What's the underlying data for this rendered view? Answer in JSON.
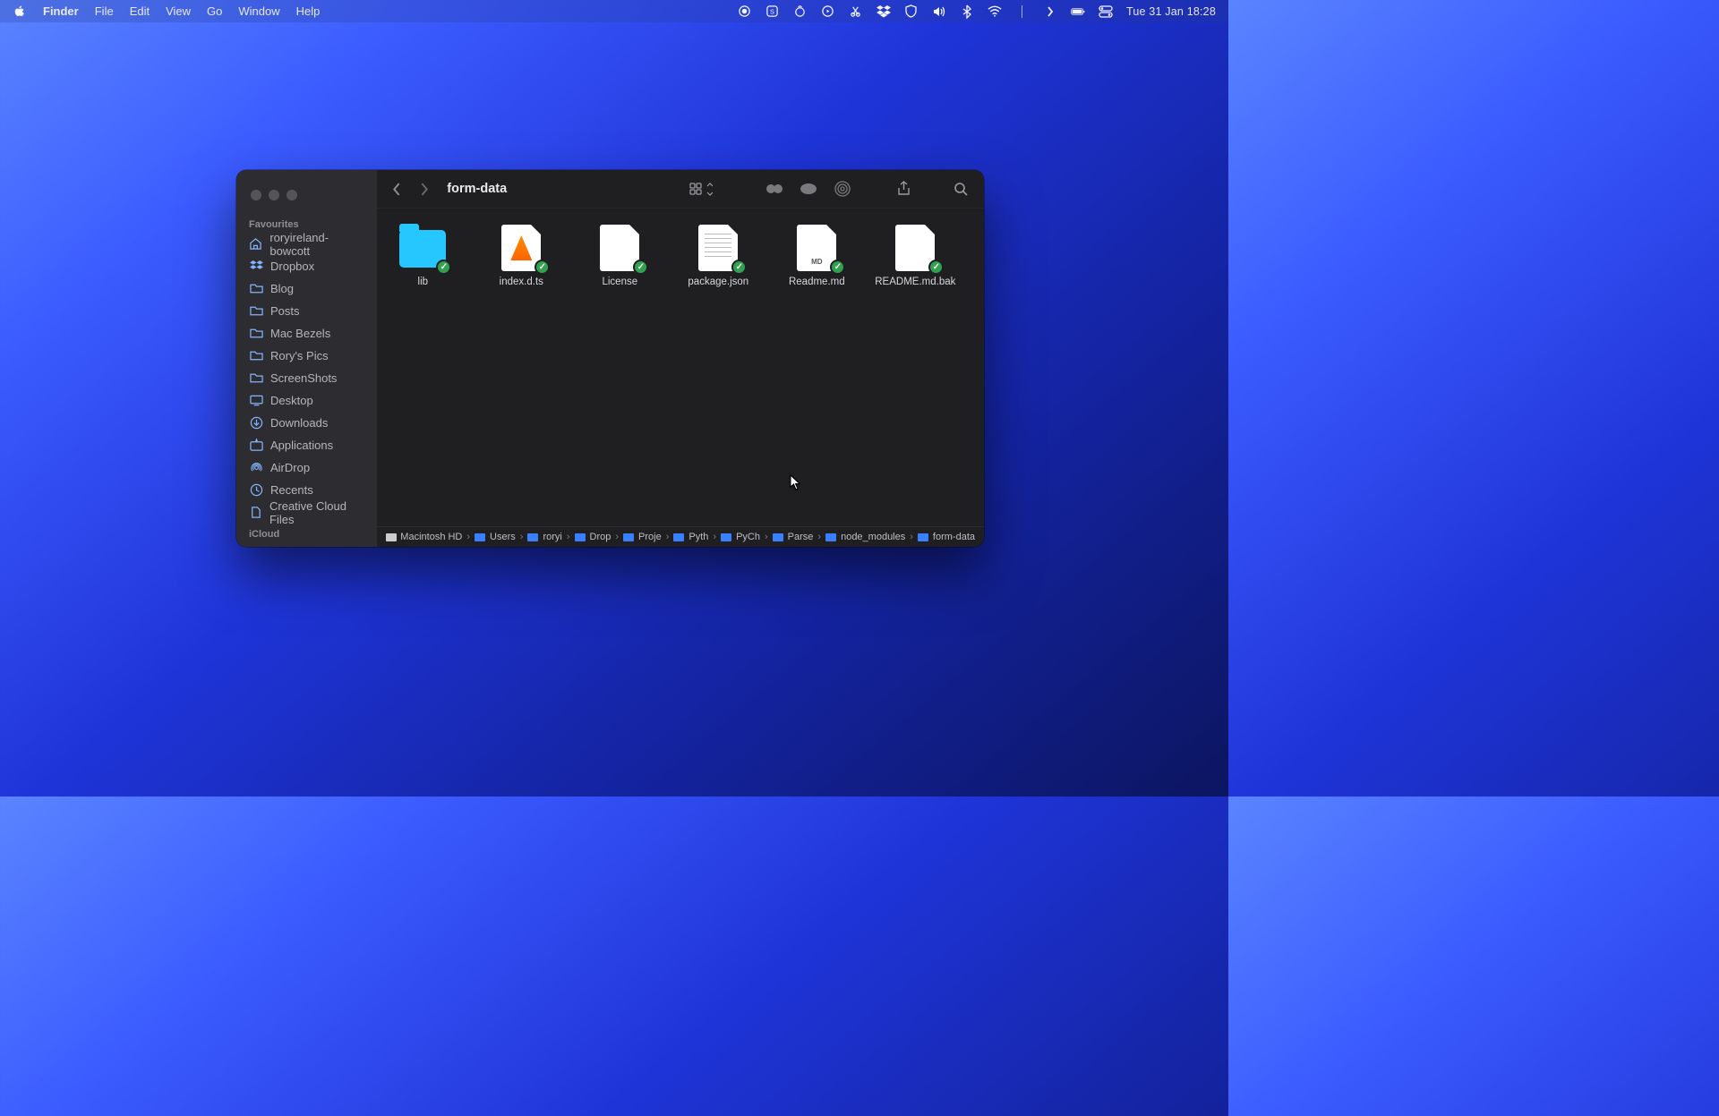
{
  "menubar": {
    "app": "Finder",
    "menus": [
      "File",
      "Edit",
      "View",
      "Go",
      "Window",
      "Help"
    ],
    "datetime": "Tue 31 Jan  18:28"
  },
  "window": {
    "title": "form-data"
  },
  "sidebar": {
    "section1_label": "Favourites",
    "section2_label": "iCloud",
    "items": [
      {
        "icon": "home",
        "label": "roryireland-bowcott"
      },
      {
        "icon": "dropbox",
        "label": "Dropbox"
      },
      {
        "icon": "folder",
        "label": "Blog"
      },
      {
        "icon": "folder",
        "label": "Posts"
      },
      {
        "icon": "folder",
        "label": "Mac Bezels"
      },
      {
        "icon": "folder",
        "label": "Rory's Pics"
      },
      {
        "icon": "folder",
        "label": "ScreenShots"
      },
      {
        "icon": "desktop",
        "label": "Desktop"
      },
      {
        "icon": "download",
        "label": "Downloads"
      },
      {
        "icon": "apps",
        "label": "Applications"
      },
      {
        "icon": "airdrop",
        "label": "AirDrop"
      },
      {
        "icon": "clock",
        "label": "Recents"
      },
      {
        "icon": "cloudfile",
        "label": "Creative Cloud Files"
      }
    ]
  },
  "files": [
    {
      "name": "lib",
      "type": "folder"
    },
    {
      "name": "index.d.ts",
      "type": "vlc"
    },
    {
      "name": "License",
      "type": "doc"
    },
    {
      "name": "package.json",
      "type": "lines"
    },
    {
      "name": "Readme.md",
      "type": "md"
    },
    {
      "name": "README.md.bak",
      "type": "doc"
    }
  ],
  "pathbar": [
    {
      "icon": "drive",
      "label": "Macintosh HD"
    },
    {
      "icon": "folder",
      "label": "Users"
    },
    {
      "icon": "folder",
      "label": "roryi"
    },
    {
      "icon": "folder",
      "label": "Drop"
    },
    {
      "icon": "folder",
      "label": "Proje"
    },
    {
      "icon": "folder",
      "label": "Pyth"
    },
    {
      "icon": "folder",
      "label": "PyCh"
    },
    {
      "icon": "folder",
      "label": "Parse"
    },
    {
      "icon": "folder",
      "label": "node_modules"
    },
    {
      "icon": "folder",
      "label": "form-data"
    }
  ]
}
